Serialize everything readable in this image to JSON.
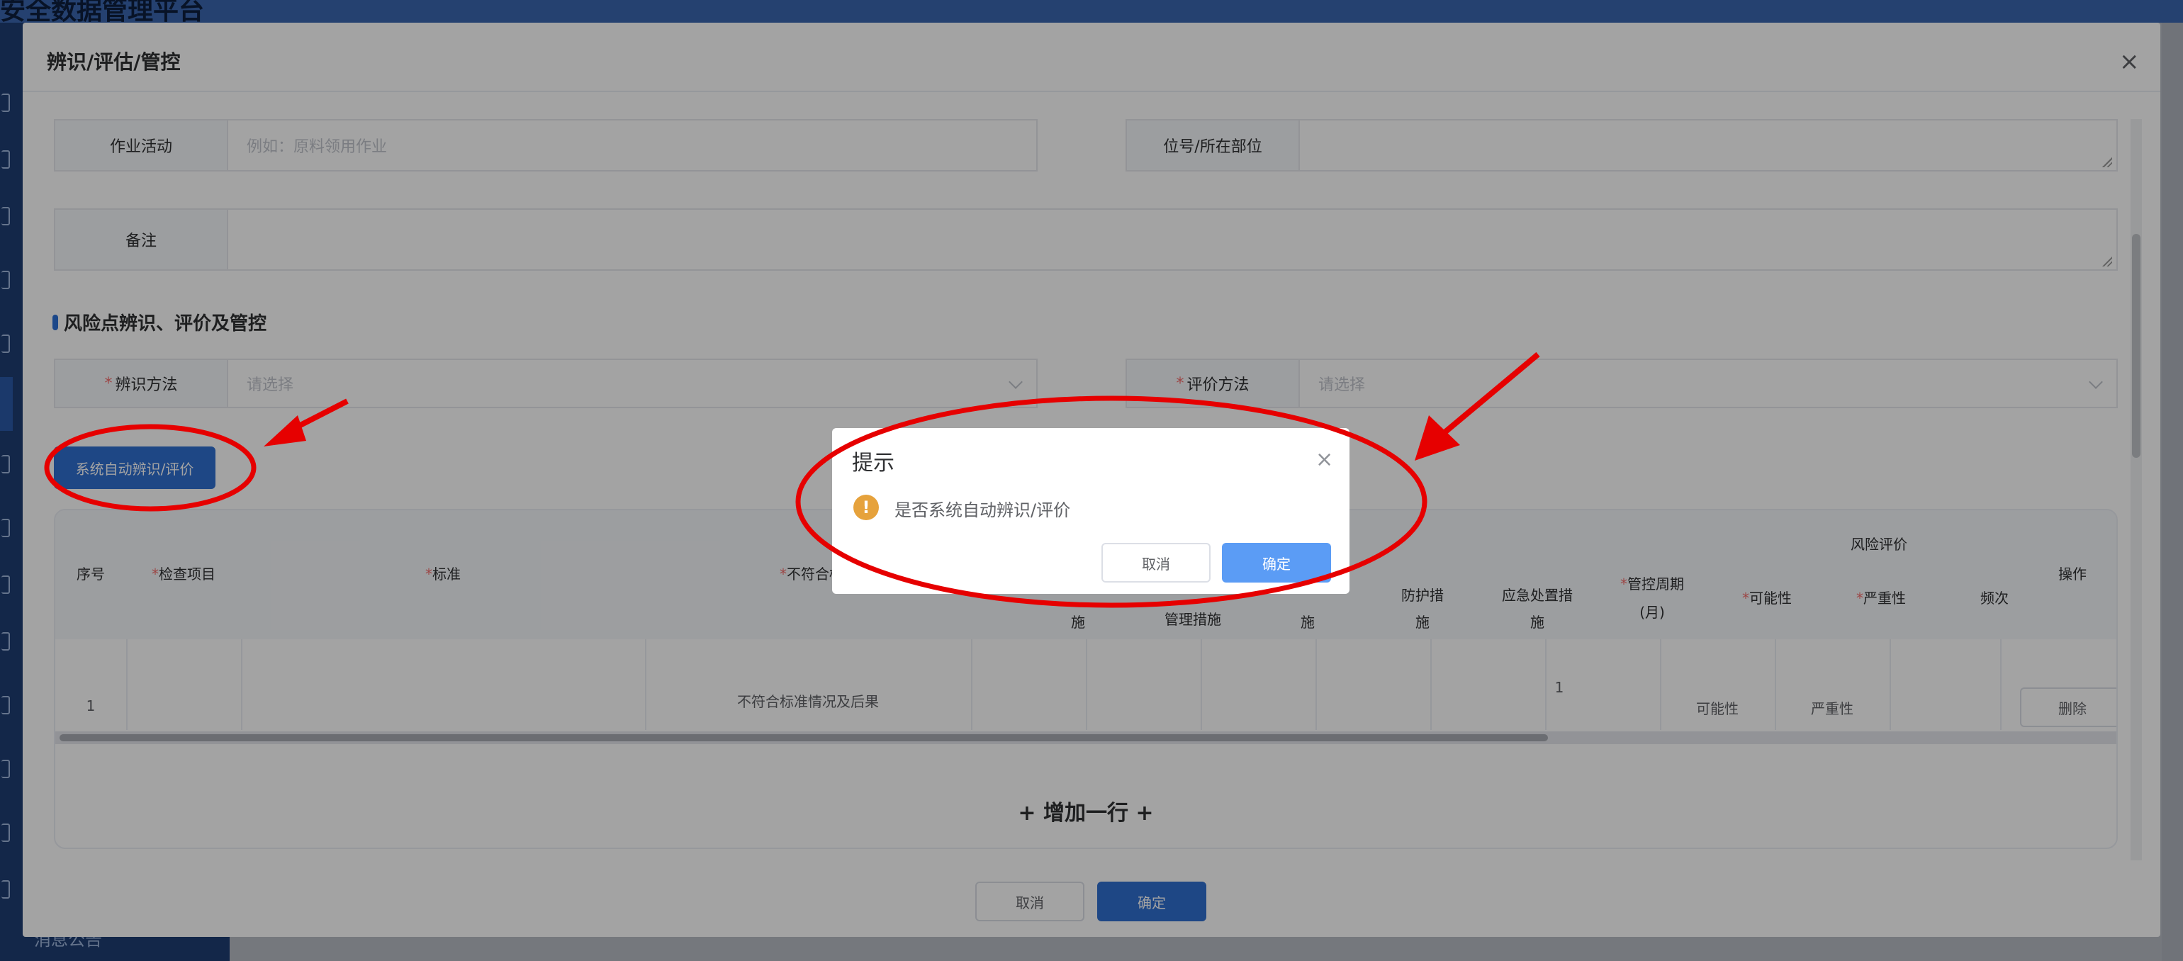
{
  "app": {
    "title": "安全数据管理平台"
  },
  "sidebar": {
    "footer_item": "消息公告"
  },
  "dialog": {
    "title": "辨识/评估/管控",
    "close_glyph": "×",
    "fields": {
      "activity_label": "作业活动",
      "activity_placeholder": "例如：原料领用作业",
      "position_label": "位号/所在部位",
      "remarks_label": "备注"
    },
    "section": {
      "title": "风险点辨识、评价及管控",
      "identify_method_label": "辨识方法",
      "identify_method_placeholder": "请选择",
      "evaluate_method_label": "评价方法",
      "evaluate_method_placeholder": "请选择",
      "auto_button": "系统自动辨识/评价"
    },
    "table": {
      "headers": {
        "index": "序号",
        "check_item": "检查项目",
        "standard": "标准",
        "nonconformity": "不符合标准情况",
        "col_frag1": "施",
        "col_frag2": "管理措施",
        "col_frag3": "施",
        "col_frag4a": "防护措",
        "col_frag4b": "施",
        "emergency_a": "应急处置措",
        "emergency_b": "施",
        "period_a": "管控周期",
        "period_b": "(月)",
        "risk_eval": "风险评价",
        "possibility": "可能性",
        "severity": "严重性",
        "frequency": "频次",
        "operation": "操作"
      },
      "rows": [
        {
          "index": "1",
          "nonconformity": "不符合标准情况及后果",
          "period": "1",
          "possibility": "可能性",
          "severity": "严重性",
          "delete": "删除"
        }
      ],
      "add_row": "+ 增加一行 +"
    },
    "footer": {
      "cancel": "取消",
      "confirm": "确定"
    }
  },
  "message_box": {
    "title": "提示",
    "close_glyph": "×",
    "icon": "warning-icon",
    "icon_glyph": "!",
    "text": "是否系统自动辨识/评价",
    "cancel": "取消",
    "confirm": "确定"
  },
  "colors": {
    "primary": "#2f6fd0",
    "primary_light": "#5b9cf5",
    "warning": "#e6a23c",
    "required": "#f56c6c",
    "annotation": "#e60000"
  }
}
